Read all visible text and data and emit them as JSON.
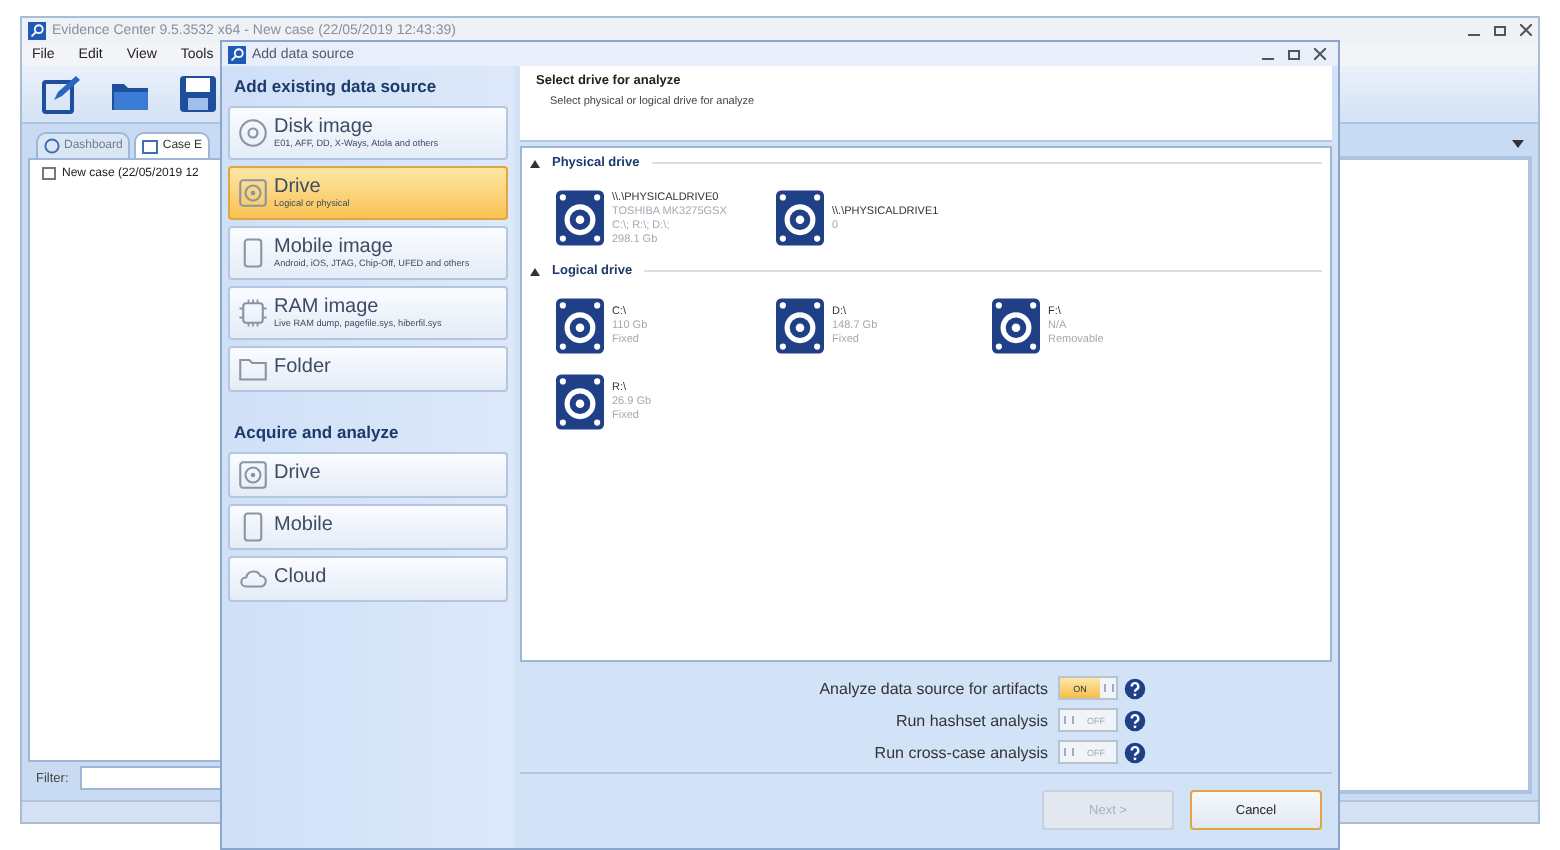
{
  "window": {
    "title": "Evidence Center 9.5.3532 x64 - New case (22/05/2019 12:43:39)"
  },
  "menu": [
    "File",
    "Edit",
    "View",
    "Tools"
  ],
  "tabs": [
    {
      "label": "Dashboard",
      "selected": false
    },
    {
      "label": "Case E",
      "selected": true
    }
  ],
  "tree": [
    {
      "label": "New case (22/05/2019 12"
    }
  ],
  "filter": {
    "label": "Filter:"
  },
  "dialog": {
    "title": "Add data source",
    "sections": [
      {
        "heading": "Add existing data source",
        "items": [
          {
            "title": "Disk image",
            "subtitle": "E01, AFF, DD, X-Ways, Atola and others",
            "kind": "disc",
            "selected": false
          },
          {
            "title": "Drive",
            "subtitle": "Logical or physical",
            "kind": "drive",
            "selected": true
          },
          {
            "title": "Mobile image",
            "subtitle": "Android, iOS, JTAG, Chip-Off, UFED and others",
            "kind": "phone",
            "selected": false
          },
          {
            "title": "RAM image",
            "subtitle": "Live RAM dump, pagefile.sys, hiberfil.sys",
            "kind": "chip",
            "selected": false
          },
          {
            "title": "Folder",
            "kind": "folder",
            "selected": false
          }
        ]
      },
      {
        "heading": "Acquire and analyze",
        "items": [
          {
            "title": "Drive",
            "kind": "drive",
            "selected": false
          },
          {
            "title": "Mobile",
            "kind": "phone",
            "selected": false
          },
          {
            "title": "Cloud",
            "kind": "cloud",
            "selected": false
          }
        ]
      }
    ],
    "header": {
      "title": "Select drive for analyze",
      "subtitle": "Select physical or logical drive for analyze"
    },
    "groups": [
      {
        "label": "Physical drive",
        "expanded": true,
        "drives": [
          {
            "name": "\\\\.\\PHYSICALDRIVE0",
            "details": [
              "TOSHIBA MK3275GSX",
              "C:\\; R:\\; D:\\;",
              "298.1 Gb"
            ]
          },
          {
            "name": "\\\\.\\PHYSICALDRIVE1",
            "details": [
              "0"
            ]
          }
        ]
      },
      {
        "label": "Logical drive",
        "expanded": true,
        "drives": [
          {
            "name": "C:\\",
            "details": [
              "110 Gb",
              "Fixed"
            ]
          },
          {
            "name": "D:\\",
            "details": [
              "148.7 Gb",
              "Fixed"
            ]
          },
          {
            "name": "F:\\",
            "details": [
              "N/A",
              "Removable"
            ]
          },
          {
            "name": "R:\\",
            "details": [
              "26.9 Gb",
              "Fixed"
            ]
          }
        ]
      }
    ],
    "options": [
      {
        "label": "Analyze data source for artifacts",
        "on": true,
        "toggle_label": "ON"
      },
      {
        "label": "Run hashset analysis",
        "on": false,
        "toggle_label": "OFF"
      },
      {
        "label": "Run cross-case analysis",
        "on": false,
        "toggle_label": "OFF"
      }
    ],
    "buttons": [
      {
        "label": "Next >",
        "disabled": true
      },
      {
        "label": "Cancel",
        "disabled": false
      }
    ]
  }
}
